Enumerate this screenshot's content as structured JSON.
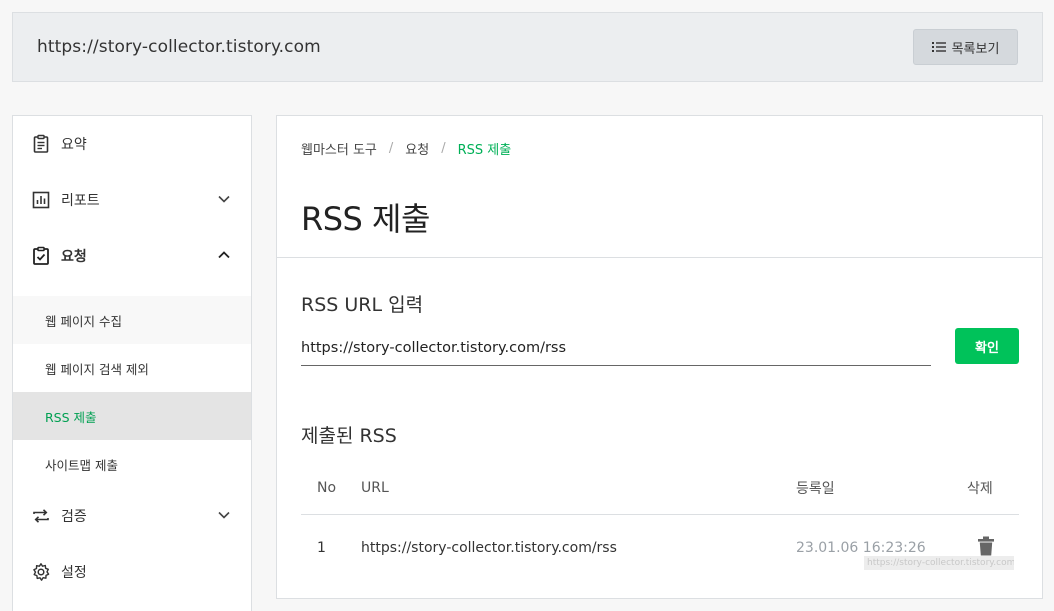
{
  "topbar": {
    "site_url": "https://story-collector.tistory.com",
    "list_button_label": "목록보기"
  },
  "sidebar": {
    "items": [
      {
        "label": "요약",
        "icon": "clipboard-icon"
      },
      {
        "label": "리포트",
        "icon": "bar-chart-icon"
      },
      {
        "label": "요청",
        "icon": "clipboard-check-icon"
      },
      {
        "label": "검증",
        "icon": "repeat-icon"
      },
      {
        "label": "설정",
        "icon": "gear-icon"
      }
    ],
    "sub_items": [
      {
        "label": "웹 페이지 수집"
      },
      {
        "label": "웹 페이지 검색 제외"
      },
      {
        "label": "RSS 제출"
      },
      {
        "label": "사이트맵 제출"
      }
    ]
  },
  "breadcrumb": {
    "items": [
      "웹마스터 도구",
      "요청",
      "RSS 제출"
    ],
    "separator": "/"
  },
  "page_title": "RSS 제출",
  "rss_input": {
    "label": "RSS URL 입력",
    "value": "https://story-collector.tistory.com/rss",
    "button_label": "확인"
  },
  "submitted": {
    "title": "제출된 RSS",
    "columns": [
      "No",
      "URL",
      "등록일",
      "삭제"
    ],
    "rows": [
      {
        "no": "1",
        "url": "https://story-collector.tistory.com/rss",
        "date": "23.01.06 16:23:26"
      }
    ]
  },
  "watermark": "https://story-collector.tistory.com",
  "colors": {
    "accent": "#00c25a",
    "active_text": "#00a052",
    "active_bg": "#e4e4e4"
  }
}
